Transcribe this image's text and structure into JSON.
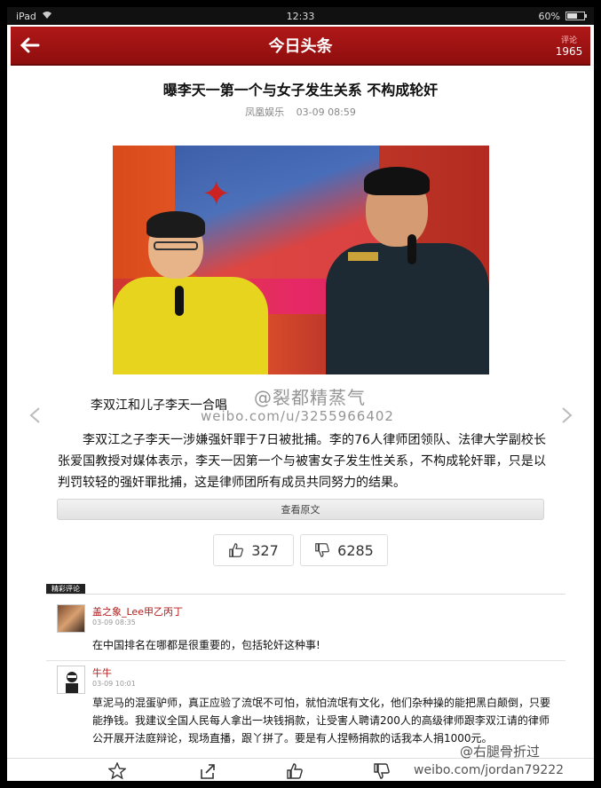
{
  "statusbar": {
    "device": "iPad",
    "time": "12:33",
    "battery": "60%",
    "battery_level": 0.6
  },
  "navbar": {
    "title": "今日头条",
    "comments_label": "评论",
    "comments_count": "1965",
    "back_icon": "arrow-left-icon"
  },
  "article": {
    "headline": "曝李天一第一个与女子发生关系 不构成轮奸",
    "source": "凤凰娱乐",
    "time": "03-09 08:59",
    "caption": "李双江和儿子李天一合唱",
    "watermark_line1": "@裂都精蒸气",
    "watermark_line2": "weibo.com/u/3255966402",
    "body": "李双江之子李天一涉嫌强奸罪于7日被批捕。李的76人律师团领队、法律大学副校长张爱国教授对媒体表示，李天一因第一个与被害女子发生性关系，不构成轮奸罪，只是以判罚较轻的强奸罪批捕，这是律师团所有成员共同努力的结果。",
    "view_original": "查看原文"
  },
  "votes": {
    "up": "327",
    "down": "6285"
  },
  "comments_section": {
    "tag": "精彩评论",
    "items": [
      {
        "user": "盖之象_Lee甲乙丙丁",
        "time": "03-09 08:35",
        "text": "在中国排名在哪都是很重要的，包括轮奸这种事!"
      },
      {
        "user": "牛牛",
        "time": "03-09 10:01",
        "text": "草泥马的混蛋驴师，真正应验了流氓不可怕，就怕流氓有文化，他们杂种操的能把黑白颠倒，只要能挣钱。我建议全国人民每人拿出一块钱捐款，让受害人聘请200人的高级律师跟李双江请的律师公开展开法庭辩论，现场直播，跟丫拼了。要是有人捏畅捐款的话我本人捐1000元。"
      }
    ]
  },
  "footer_watermark": {
    "handle": "@右腿骨折过",
    "url": "weibo.com/jordan79222"
  },
  "colors": {
    "nav_red": "#a01414",
    "username_red": "#b11c1c"
  }
}
